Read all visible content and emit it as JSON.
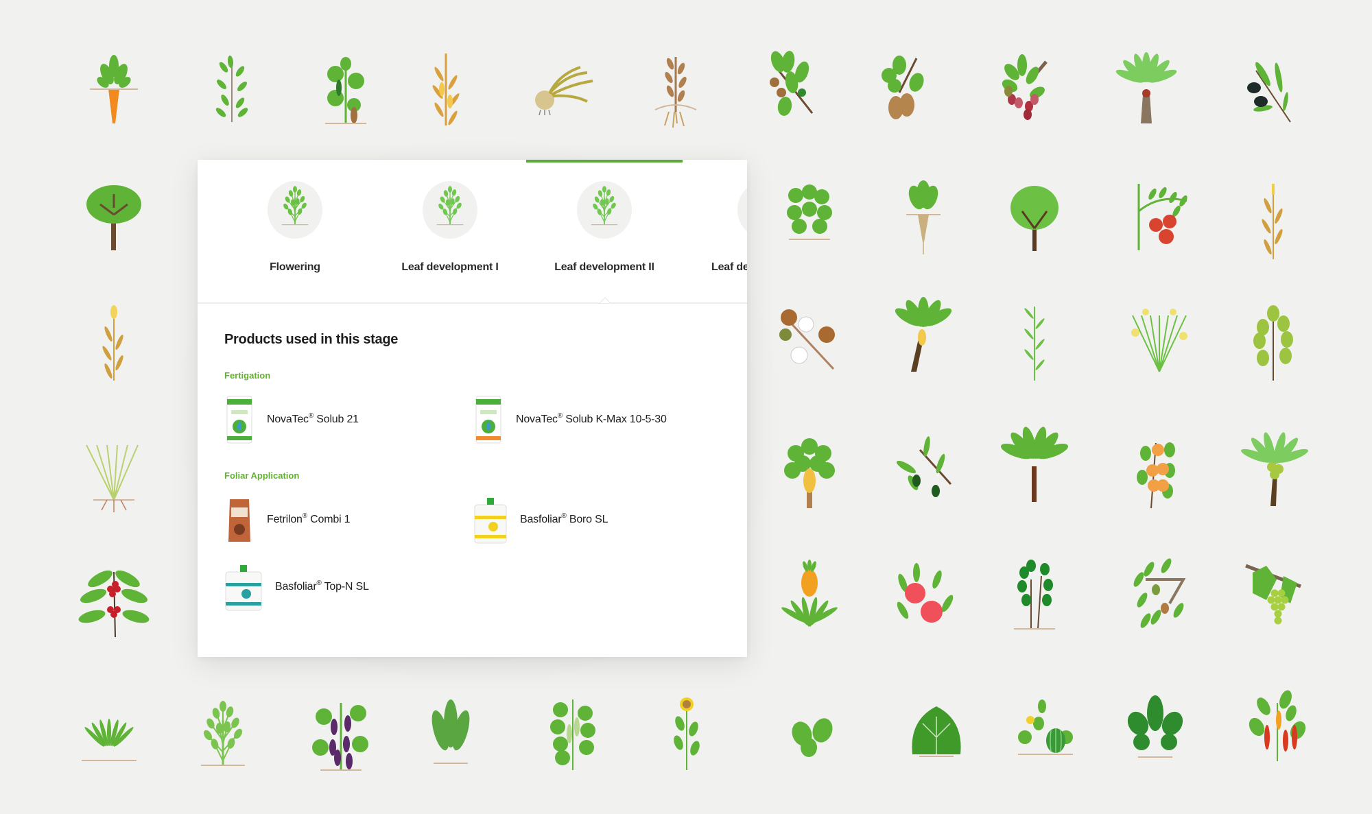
{
  "stage_tabs": [
    {
      "label": "Flowering",
      "active": false
    },
    {
      "label": "Leaf development I",
      "active": false
    },
    {
      "label": "Leaf development II",
      "active": true
    },
    {
      "label": "Leaf de",
      "active": false
    }
  ],
  "products_section": {
    "title": "Products used in this stage",
    "categories": [
      {
        "name": "Fertigation",
        "products": [
          {
            "brand": "NovaTec",
            "mark": "®",
            "suffix": " Solub 21",
            "image": "fertilizer-bag-green"
          },
          {
            "brand": "NovaTec",
            "mark": "®",
            "suffix": " Solub K-Max 10-5-30",
            "image": "fertilizer-bag-orange"
          }
        ]
      },
      {
        "name": "Foliar Application",
        "products": [
          {
            "brand": "Fetrilon",
            "mark": "®",
            "suffix": " Combi 1",
            "image": "fertilizer-bag-brown"
          },
          {
            "brand": "Basfoliar",
            "mark": "®",
            "suffix": " Boro SL",
            "image": "canister-yellow"
          },
          {
            "brand": "Basfoliar",
            "mark": "®",
            "suffix": " Top-N SL",
            "image": "canister-teal"
          }
        ]
      }
    ]
  },
  "background_crops": [
    "carrot",
    "shrub",
    "cucumber",
    "corn",
    "onion",
    "soybean",
    "hazelnut",
    "kiwi",
    "lychee",
    "date-palm",
    "olive",
    "tree",
    "strawberry",
    "sugar-beet",
    "almond-tree",
    "tomato",
    "wheat",
    "millet",
    "cotton",
    "banana-palm",
    "sugarcane",
    "rice",
    "bean",
    "sugarcane-grass",
    "papaya",
    "avocado",
    "banana",
    "apricot",
    "coconut",
    "coffee",
    "pineapple",
    "pomegranate",
    "tea",
    "pistachio",
    "grape",
    "grass",
    "alfalfa",
    "eggplant",
    "lettuce",
    "pea",
    "sunflower",
    "zucchini",
    "cabbage",
    "watermelon",
    "spinach",
    "chili-pepper"
  ],
  "colors": {
    "accent": "#5aaa3c",
    "category_label": "#62b22f",
    "background": "#f1f2ef"
  }
}
